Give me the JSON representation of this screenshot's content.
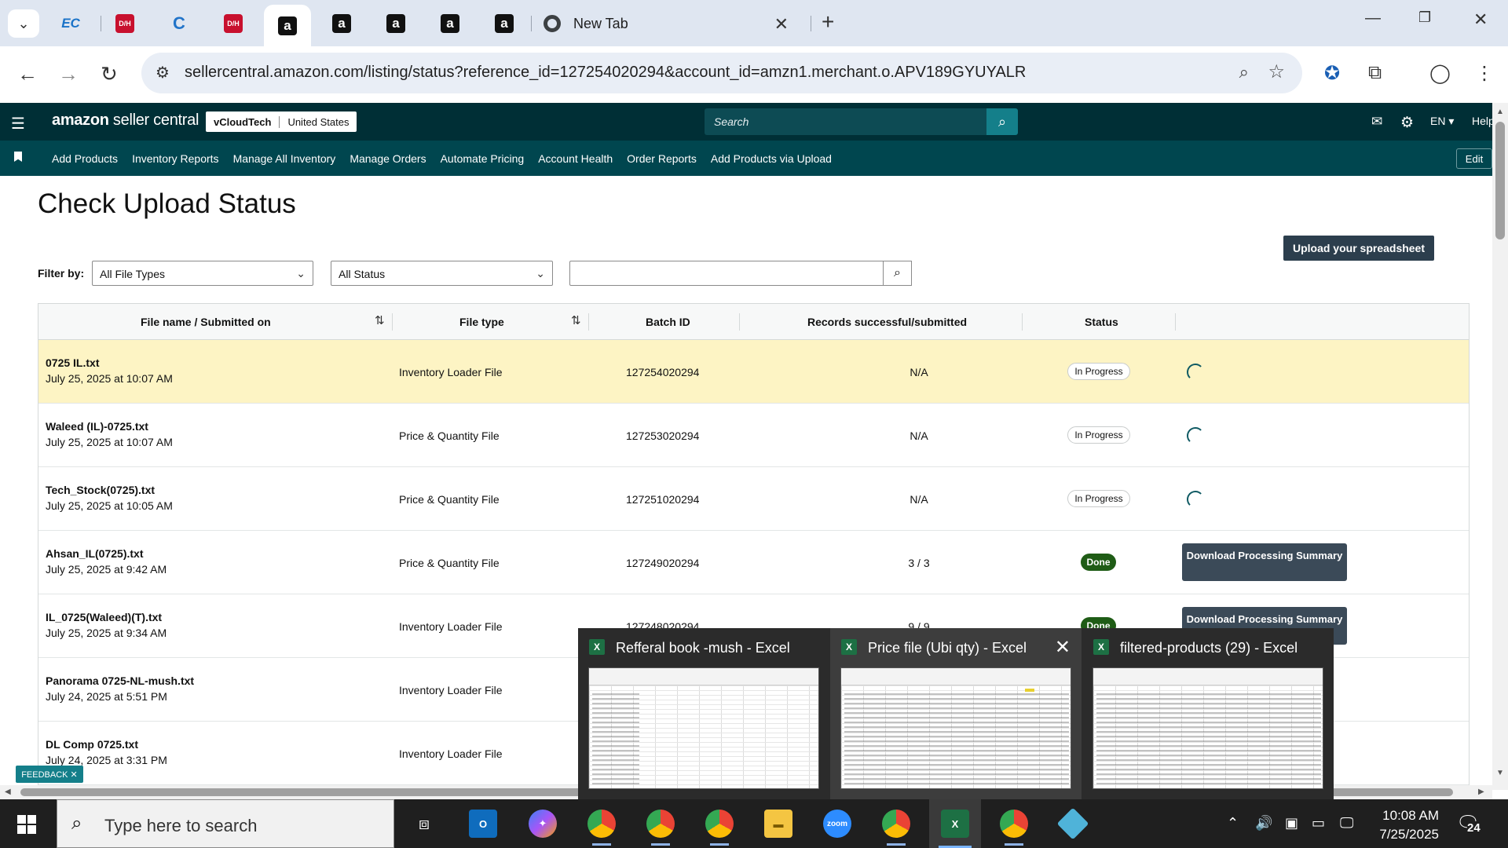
{
  "browser": {
    "new_tab_label": "New Tab",
    "url": "sellercentral.amazon.com/listing/status?reference_id=127254020294&account_id=amzn1.merchant.o.APV189GYUYALR",
    "tab_favicons": [
      "EC",
      "D/H",
      "C",
      "D/H",
      "a",
      "a",
      "a",
      "a",
      "a"
    ]
  },
  "seller": {
    "brand_prefix": "amazon",
    "brand_suffix": " seller central",
    "account_name": "vCloudTech",
    "marketplace": "United States",
    "search_placeholder": "Search",
    "language": "EN ▾",
    "help": "Help",
    "edit": "Edit",
    "nav": [
      "Add Products",
      "Inventory Reports",
      "Manage All Inventory",
      "Manage Orders",
      "Automate Pricing",
      "Account Health",
      "Order Reports",
      "Add Products via Upload"
    ]
  },
  "page": {
    "title": "Check Upload Status",
    "upload_button": "Upload your spreadsheet",
    "filter_label": "Filter by:",
    "file_type_filter": "All File Types",
    "status_filter": "All Status",
    "feedback": "FEEDBACK ✕"
  },
  "table": {
    "headers": [
      "File name / Submitted on",
      "File type",
      "Batch ID",
      "Records successful/submitted",
      "Status"
    ],
    "rows": [
      {
        "name": "0725 IL.txt",
        "date": "July 25, 2025 at 10:07 AM",
        "type": "Inventory Loader File",
        "batch": "127254020294",
        "records": "N/A",
        "status": "In Progress",
        "highlight": true
      },
      {
        "name": "Waleed (IL)-0725.txt",
        "date": "July 25, 2025 at 10:07 AM",
        "type": "Price & Quantity File",
        "batch": "127253020294",
        "records": "N/A",
        "status": "In Progress"
      },
      {
        "name": "Tech_Stock(0725).txt",
        "date": "July 25, 2025 at 10:05 AM",
        "type": "Price & Quantity File",
        "batch": "127251020294",
        "records": "N/A",
        "status": "In Progress"
      },
      {
        "name": "Ahsan_IL(0725).txt",
        "date": "July 25, 2025 at 9:42 AM",
        "type": "Price & Quantity File",
        "batch": "127249020294",
        "records": "3 / 3",
        "status": "Done",
        "action": "Download Processing Summary"
      },
      {
        "name": "IL_0725(Waleed)(T).txt",
        "date": "July 25, 2025 at 9:34 AM",
        "type": "Inventory Loader File",
        "batch": "127248020294",
        "records": "9 / 9",
        "status": "Done",
        "action": "Download Processing Summary"
      },
      {
        "name": "Panorama 0725-NL-mush.txt",
        "date": "July 24, 2025 at 5:51 PM",
        "type": "Inventory Loader File"
      },
      {
        "name": "DL Comp 0725.txt",
        "date": "July 24, 2025 at 3:31 PM",
        "type": "Inventory Loader File"
      }
    ]
  },
  "previews": [
    {
      "title": "Refferal book -mush - Excel"
    },
    {
      "title": "Price file (Ubi qty) - Excel"
    },
    {
      "title": "filtered-products (29) - Excel"
    }
  ],
  "taskbar": {
    "search_placeholder": "Type here to search",
    "time": "10:08 AM",
    "date": "7/25/2025",
    "notifications": "24"
  }
}
